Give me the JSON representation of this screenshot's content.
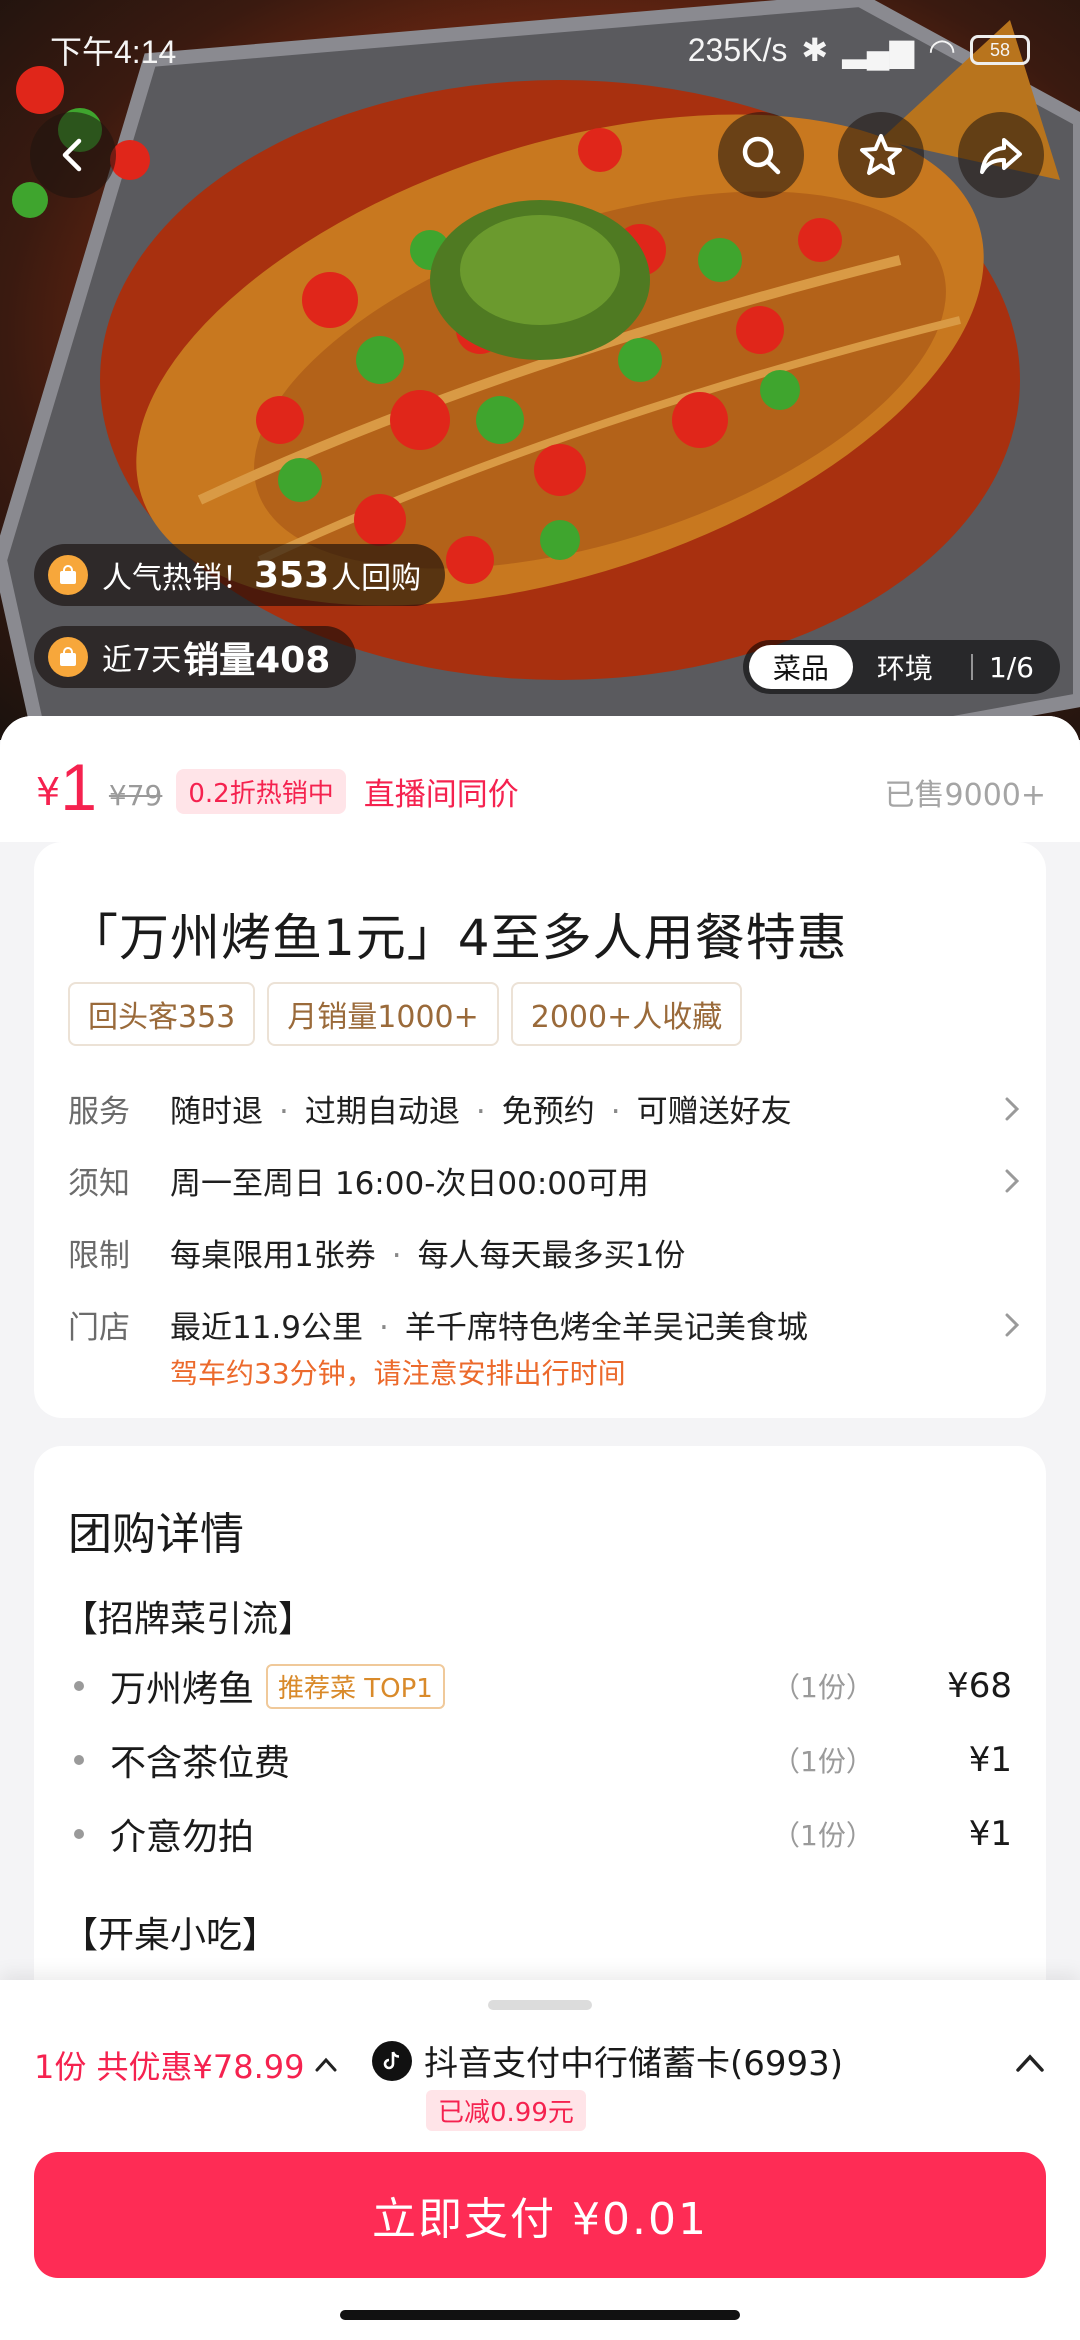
{
  "status_bar": {
    "time": "下午4:14",
    "net_speed": "235K/s",
    "battery": "58"
  },
  "hero": {
    "badges": [
      {
        "prefix": "人气热销！",
        "number": "353",
        "suffix": "人回购"
      },
      {
        "prefix": "近7天",
        "number": "销量408",
        "suffix": ""
      }
    ],
    "photo_tabs": [
      "菜品",
      "环境"
    ],
    "photo_counter": "1/6",
    "icons": [
      "back-icon",
      "search-icon",
      "star-icon",
      "share-icon"
    ]
  },
  "price": {
    "currency": "¥",
    "current": "1",
    "original": "¥79",
    "discount": "0.2折热销中",
    "same_price": "直播间同价",
    "sold": "已售9000+"
  },
  "deal": {
    "title": "「万州烤鱼1元」4至多人用餐特惠",
    "tags": [
      "回头客353",
      "月销量1000+",
      "2000+人收藏"
    ],
    "service": {
      "label": "服务",
      "items": [
        "随时退",
        "过期自动退",
        "免预约",
        "可赠送好友"
      ]
    },
    "notice": {
      "label": "须知",
      "value": "周一至周日 16:00-次日00:00可用"
    },
    "limit": {
      "label": "限制",
      "items": [
        "每桌限用1张券",
        "每人每天最多买1份"
      ]
    },
    "store": {
      "label": "门店",
      "items": [
        "最近11.9公里",
        "羊千席特色烤全羊吴记美食城"
      ],
      "hint": "驾车约33分钟，请注意安排出行时间"
    }
  },
  "details": {
    "title": "团购详情",
    "groups": [
      {
        "name": "【招牌菜引流】",
        "items": [
          {
            "name": "万州烤鱼",
            "tag": "推荐菜 TOP1",
            "qty": "（1份）",
            "price": "¥68"
          },
          {
            "name": "不含茶位费",
            "tag": "",
            "qty": "（1份）",
            "price": "¥1"
          },
          {
            "name": "介意勿拍",
            "tag": "",
            "qty": "（1份）",
            "price": "¥1"
          }
        ]
      },
      {
        "name": "【开桌小吃】",
        "items": []
      }
    ]
  },
  "checkout": {
    "summary": "1份  共优惠¥78.99",
    "pay_method": "抖音支付中行储蓄卡(6993)",
    "reduced": "已减0.99元",
    "pay_button": "立即支付 ¥0.01"
  },
  "colors": {
    "accent": "#fe2c55",
    "price_red": "#f5224f",
    "hint_orange": "#ec6a2c",
    "tag_brown": "#9a6a3a"
  }
}
